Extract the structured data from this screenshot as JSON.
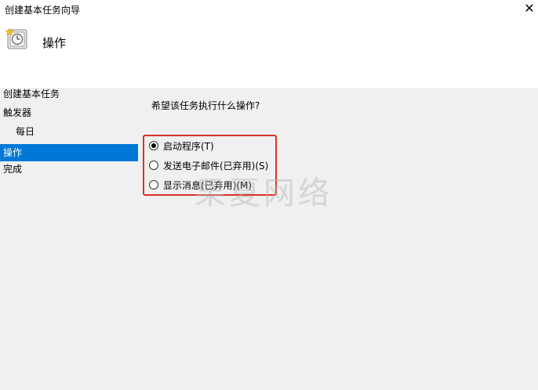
{
  "window": {
    "title": "创建基本任务向导",
    "close_glyph": "✕"
  },
  "header": {
    "heading": "操作",
    "icon": "clock-task-icon"
  },
  "sidebar": {
    "items": [
      {
        "label": "创建基本任务"
      },
      {
        "label": "触发器"
      },
      {
        "label": "每日"
      },
      {
        "label": "操作"
      },
      {
        "label": "完成"
      }
    ],
    "selected_index": 3
  },
  "main": {
    "question": "希望该任务执行什么操作?",
    "options": [
      {
        "label": "启动程序(T)",
        "checked": true
      },
      {
        "label": "发送电子邮件(已弃用)(S)",
        "checked": false
      },
      {
        "label": "显示消息(已弃用)(M)",
        "checked": false
      }
    ]
  },
  "colors": {
    "selection": "#0078d7",
    "highlight_box": "#d9302b",
    "background": "#f0f0f0"
  },
  "watermark": "果夏网络"
}
